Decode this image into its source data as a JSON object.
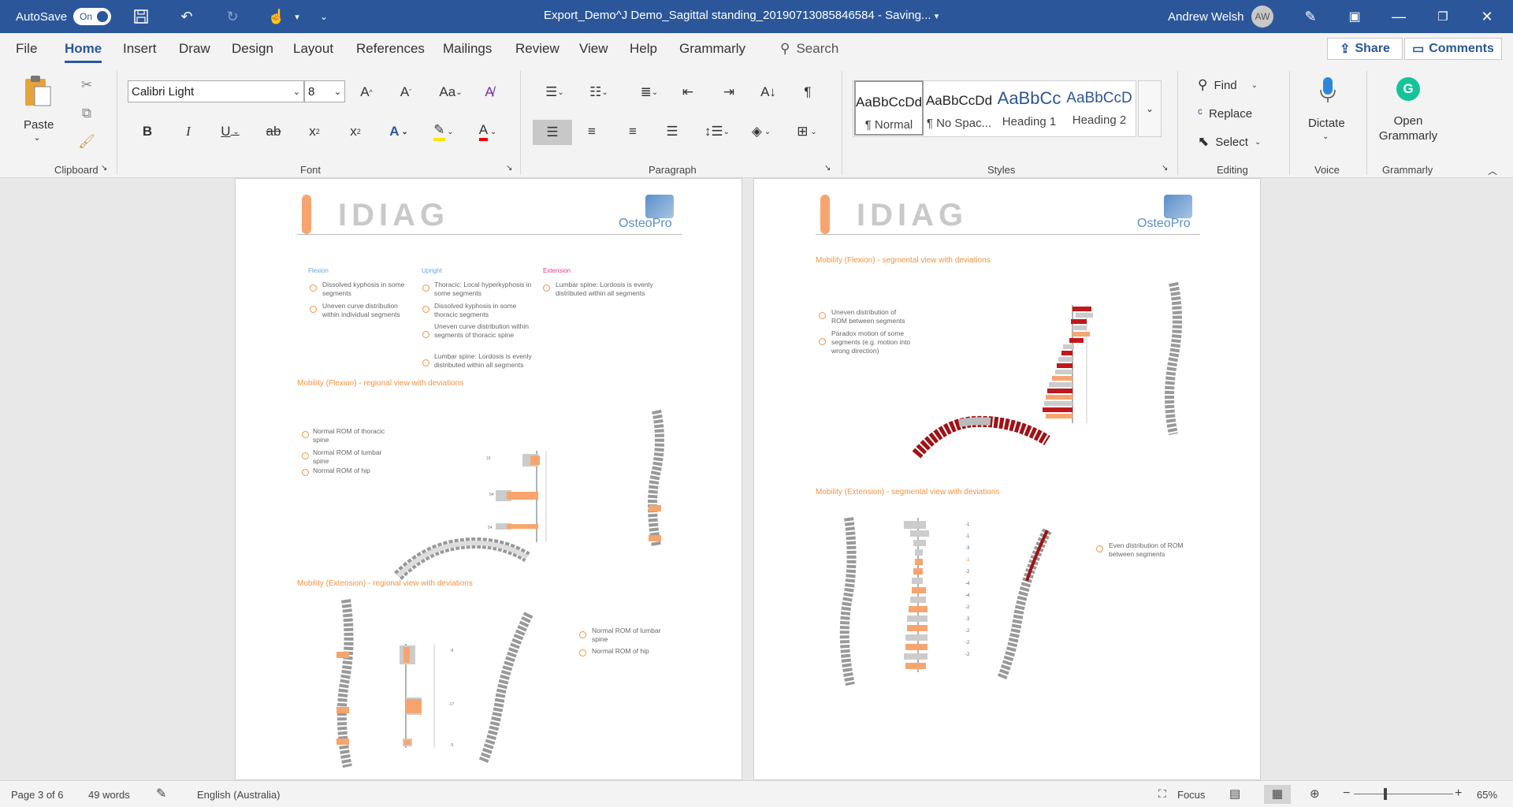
{
  "titlebar": {
    "autosave_label": "AutoSave",
    "autosave_state": "On",
    "doc_title": "Export_Demo^J Demo_Sagittal standing_20190713085846584  -  Saving...",
    "user_name": "Andrew Welsh",
    "user_initials": "AW"
  },
  "menu": {
    "items": [
      "File",
      "Home",
      "Insert",
      "Draw",
      "Design",
      "Layout",
      "References",
      "Mailings",
      "Review",
      "View",
      "Help",
      "Grammarly"
    ],
    "active": "Home",
    "search": "Search",
    "share": "Share",
    "comments": "Comments"
  },
  "ribbon": {
    "clipboard": {
      "label": "Clipboard",
      "paste": "Paste"
    },
    "font": {
      "label": "Font",
      "name": "Calibri Light",
      "size": "8"
    },
    "paragraph": {
      "label": "Paragraph"
    },
    "styles": {
      "label": "Styles",
      "items": [
        {
          "sample": "AaBbCcDd",
          "name": "¶ Normal"
        },
        {
          "sample": "AaBbCcDd",
          "name": "¶ No Spac..."
        },
        {
          "sample": "AaBbCc",
          "name": "Heading 1"
        },
        {
          "sample": "AaBbCcD",
          "name": "Heading 2"
        }
      ]
    },
    "editing": {
      "label": "Editing",
      "find": "Find",
      "replace": "Replace",
      "select": "Select"
    },
    "voice": {
      "label": "Voice",
      "dictate": "Dictate"
    },
    "grammarly": {
      "label": "Grammarly",
      "open": "Open Grammarly"
    }
  },
  "page1": {
    "logo": "IDIAG",
    "brand": "OsteoPro",
    "columns": {
      "flexion": {
        "title": "Flexion",
        "items": [
          "Dissolved kyphosis in some segments",
          "Uneven curve distribution within individual segments"
        ]
      },
      "upright": {
        "title": "Upright",
        "items": [
          "Thoracic: Local hyperkyphosis in some segments",
          "Dissolved kyphosis in some thoracic segments",
          "Uneven curve distribution within segments of thoracic spine",
          "Lumbar spine: Lordosis is evenly distributed within all segments"
        ]
      },
      "extension": {
        "title": "Extension",
        "items": [
          "Lumbar spine: Lordosis is evenly distributed within all segments"
        ]
      }
    },
    "section_flexion": "Mobility (Flexion) - regional view with deviations",
    "flexion_items": [
      "Normal ROM of thoracic spine",
      "Normal ROM of lumbar spine",
      "Normal ROM of hip"
    ],
    "flexion_values": [
      "16",
      "54",
      "54"
    ],
    "section_extension": "Mobility (Extension) - regional view with deviations",
    "extension_items": [
      "Normal ROM of lumbar spine",
      "Normal ROM of hip"
    ],
    "extension_values": [
      "-8",
      "-17",
      "-5"
    ]
  },
  "page2": {
    "logo": "IDIAG",
    "brand": "OsteoPro",
    "section_flexion": "Mobility (Flexion) - segmental view with deviations",
    "flexion_items": [
      "Uneven distribution of ROM between segments",
      "Paradox motion of some segments (e.g. motion into wrong direction)"
    ],
    "section_extension": "Mobility (Extension) - segmental view with deviations",
    "extension_items": [
      "Even distribution of ROM between segments"
    ],
    "extension_values": [
      "-1",
      "-1",
      "-3",
      "-3",
      "-2",
      "-4",
      "-4",
      "-2",
      "-3",
      "-2",
      "-2",
      "-2"
    ]
  },
  "status": {
    "page": "Page 3 of 6",
    "words": "49 words",
    "language": "English (Australia)",
    "focus": "Focus",
    "zoom": "65%"
  },
  "colors": {
    "accent": "#2b579a",
    "orange": "#f59342",
    "red": "#c0181e"
  }
}
